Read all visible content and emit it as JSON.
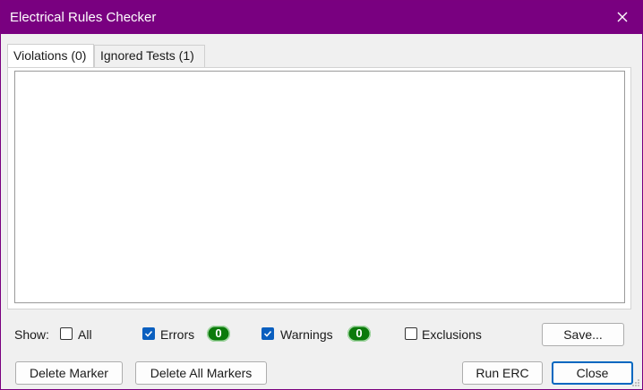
{
  "window": {
    "title": "Electrical Rules Checker"
  },
  "tabs": [
    {
      "label": "Violations (0)",
      "selected": true
    },
    {
      "label": "Ignored Tests (1)",
      "selected": false
    }
  ],
  "filters": {
    "show_label": "Show:",
    "all": {
      "label": "All",
      "checked": false
    },
    "errors": {
      "label": "Errors",
      "checked": true,
      "count": "0"
    },
    "warnings": {
      "label": "Warnings",
      "checked": true,
      "count": "0"
    },
    "exclusions": {
      "label": "Exclusions",
      "checked": false
    }
  },
  "buttons": {
    "save": "Save...",
    "delete_marker": "Delete Marker",
    "delete_all_markers": "Delete All Markers",
    "run_erc": "Run ERC",
    "close": "Close"
  },
  "colors": {
    "titlebar": "#790080",
    "badge": "#0b7a0b",
    "accent": "#0067c0"
  },
  "icons": {
    "close": "close-icon",
    "check": "checkmark-icon",
    "resize": "resize-grip-icon"
  }
}
